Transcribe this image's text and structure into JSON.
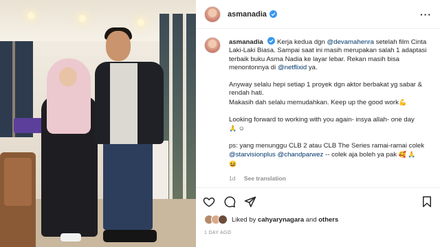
{
  "post": {
    "username": "asmanadia",
    "caption": {
      "p1_part1": "Kerja kedua dgn ",
      "p1_mention1": "@devamahenra",
      "p1_part2": " setelah film Cinta Laki-Laki Biasa. Sampai saat ini masih merupakan salah 1 adaptasi terbaik buku Asma Nadia ke layar lebar. Rekan masih bisa menontonnya di ",
      "p1_mention2": "@netflixid",
      "p1_part3": " ya.",
      "p2": "Anyway selalu hepi setiap 1 proyek dgn aktor berbakat yg sabar & rendah hati.",
      "p3": "Makasih dah selalu memudahkan. Keep up the good work",
      "p3_emoji": "💪",
      "p4": "Looking forward to working with you again- insya allah- one day",
      "p4_emoji": "🙏 ☺",
      "p5_part1": "ps: yang menunggu CLB 2 atau CLB The Series ramai-ramai colek ",
      "p5_mention1": "@starvisionplus",
      "p5_mention2": "@chandparwez",
      "p5_part2": " -- colek aja boleh ya pak ",
      "p5_emoji": "🥰 🙏",
      "p5_emoji2": "😆"
    },
    "meta_time": "1d",
    "see_translation": "See translation",
    "liked_by_prefix": "Liked by ",
    "liked_by_user": "cahyarynagara",
    "liked_by_and": " and ",
    "liked_by_others": "others",
    "posted_ago": "1 DAY AGO"
  },
  "icons": {
    "verified": "verified-badge-icon",
    "more": "more-options-icon",
    "like": "heart-icon",
    "comment": "comment-icon",
    "share": "share-icon",
    "save": "bookmark-icon"
  },
  "colors": {
    "link": "#00376b",
    "verified": "#3897f0",
    "muted": "#8e8e8e"
  }
}
